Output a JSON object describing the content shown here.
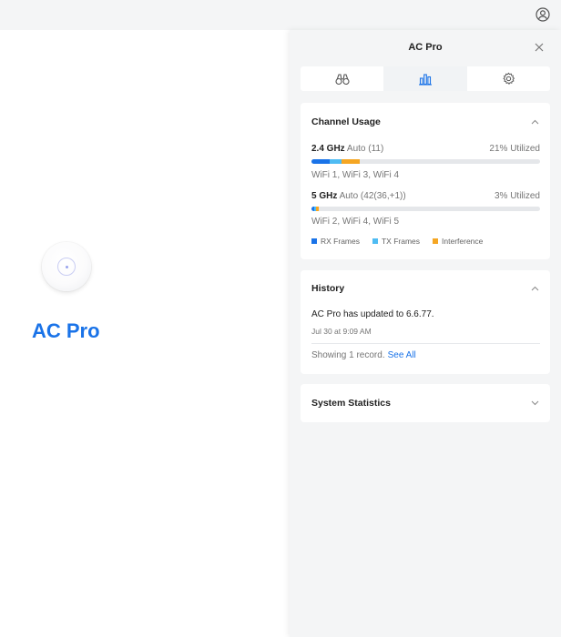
{
  "device": {
    "name": "AC Pro"
  },
  "panel": {
    "title": "AC Pro",
    "tabs": [
      {
        "icon": "binoculars-icon"
      },
      {
        "icon": "bar-chart-icon",
        "active": true
      },
      {
        "icon": "gear-icon"
      }
    ]
  },
  "channel_usage": {
    "title": "Channel Usage",
    "bands": [
      {
        "band": "2.4 GHz",
        "channel": "Auto (11)",
        "utilized": "21% Utilized",
        "rx_pct": 8,
        "tx_pct": 5,
        "interference_pct": 8,
        "networks": "WiFi 1, WiFi 3, WiFi 4"
      },
      {
        "band": "5 GHz",
        "channel": "Auto (42(36,+1))",
        "utilized": "3% Utilized",
        "rx_pct": 1,
        "tx_pct": 1,
        "interference_pct": 1,
        "networks": "WiFi 2, WiFi 4, WiFi 5"
      }
    ],
    "legend": {
      "rx": "RX Frames",
      "tx": "TX Frames",
      "interference": "Interference"
    }
  },
  "history": {
    "title": "History",
    "message": "AC Pro has updated to 6.6.77.",
    "time": "Jul 30 at 9:09 AM",
    "footer": "Showing 1 record.",
    "see_all": "See All"
  },
  "system_statistics": {
    "title": "System Statistics"
  },
  "colors": {
    "accent": "#1a73e8",
    "rx": "#1a73e8",
    "tx": "#4fbcf3",
    "interference": "#f5a623"
  }
}
